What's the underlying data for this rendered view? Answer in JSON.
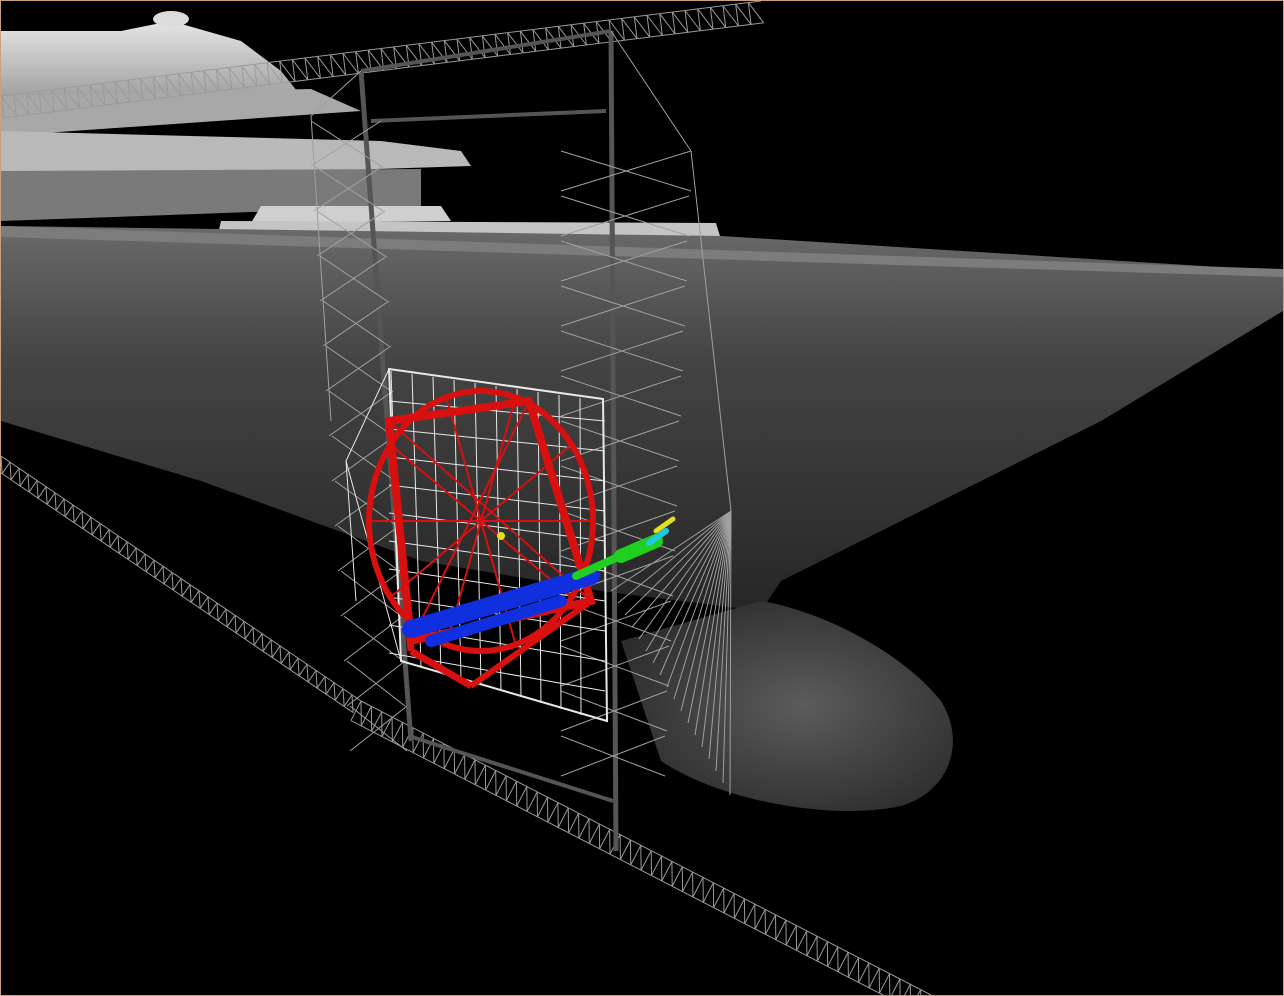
{
  "scene": {
    "colors": {
      "background": "#000000",
      "hull": "#3e3e3e",
      "hull_light": "#5a5a5a",
      "superstructure": "#bdbdbd",
      "truss": "#9a9a9a",
      "frame_white": "#e8e8e8",
      "telescope_red": "#d81010",
      "actuator_blue": "#1030e0",
      "instrument_green": "#20d020",
      "instrument_yellow": "#e0e020",
      "instrument_cyan": "#20c8e0",
      "border": "#c8a080"
    }
  }
}
